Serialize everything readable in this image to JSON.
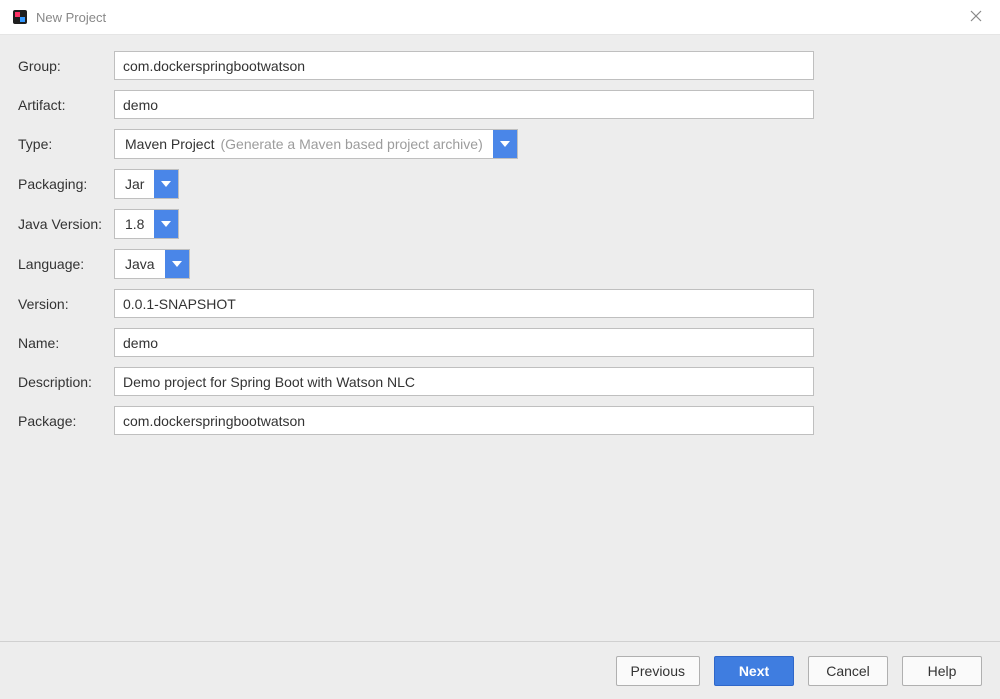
{
  "window": {
    "title": "New Project"
  },
  "form": {
    "labels": {
      "group": "Group:",
      "artifact": "Artifact:",
      "type": "Type:",
      "packaging": "Packaging:",
      "javaVersion": "Java Version:",
      "language": "Language:",
      "version": "Version:",
      "name": "Name:",
      "description": "Description:",
      "package": "Package:"
    },
    "values": {
      "group": "com.dockerspringbootwatson",
      "artifact": "demo",
      "type": "Maven Project",
      "typeHint": "(Generate a Maven based project archive)",
      "packaging": "Jar",
      "javaVersion": "1.8",
      "language": "Java",
      "version": "0.0.1-SNAPSHOT",
      "name": "demo",
      "description": "Demo project for Spring Boot with Watson NLC",
      "package": "com.dockerspringbootwatson"
    }
  },
  "footer": {
    "previous": "Previous",
    "next": "Next",
    "cancel": "Cancel",
    "help": "Help"
  },
  "colors": {
    "accent": "#3f7de0",
    "panel": "#ededed"
  }
}
